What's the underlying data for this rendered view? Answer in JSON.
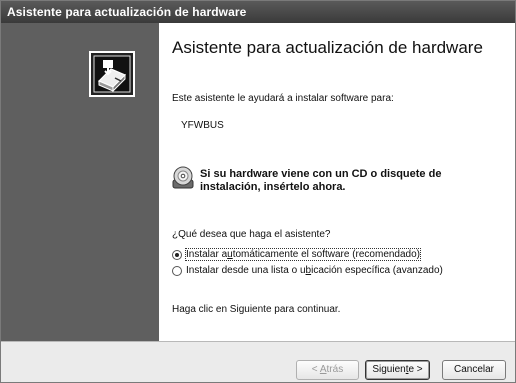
{
  "window": {
    "title": "Asistente para actualización de hardware"
  },
  "main": {
    "heading": "Asistente para actualización de hardware",
    "intro": "Este asistente le ayudará a instalar software para:",
    "device_name": "YFWBUS",
    "cd_notice": "Si su hardware viene con un CD o disquete de instalación, insértelo ahora.",
    "question": "¿Qué desea que haga el asistente?",
    "options": [
      {
        "pre": "Instalar a",
        "accel": "u",
        "post": "tomáticamente el software (recomendado)",
        "selected": true
      },
      {
        "pre": "Instalar desde una lista o u",
        "accel": "b",
        "post": "icación específica (avanzado)",
        "selected": false
      }
    ],
    "footer": "Haga clic en Siguiente para continuar."
  },
  "buttons": {
    "back": {
      "pre": "< ",
      "accel": "A",
      "post": "trás",
      "enabled": false
    },
    "next": {
      "pre": "Siguien",
      "accel": "t",
      "post": "e >",
      "enabled": true
    },
    "cancel": "Cancelar"
  },
  "icons": {
    "panel": "hardware-install-icon",
    "cd": "cd-disc-icon"
  },
  "colors": {
    "titlebar": "#4a4a4a",
    "left_panel": "#5f5f5f",
    "bottom_bar": "#ebebeb"
  }
}
